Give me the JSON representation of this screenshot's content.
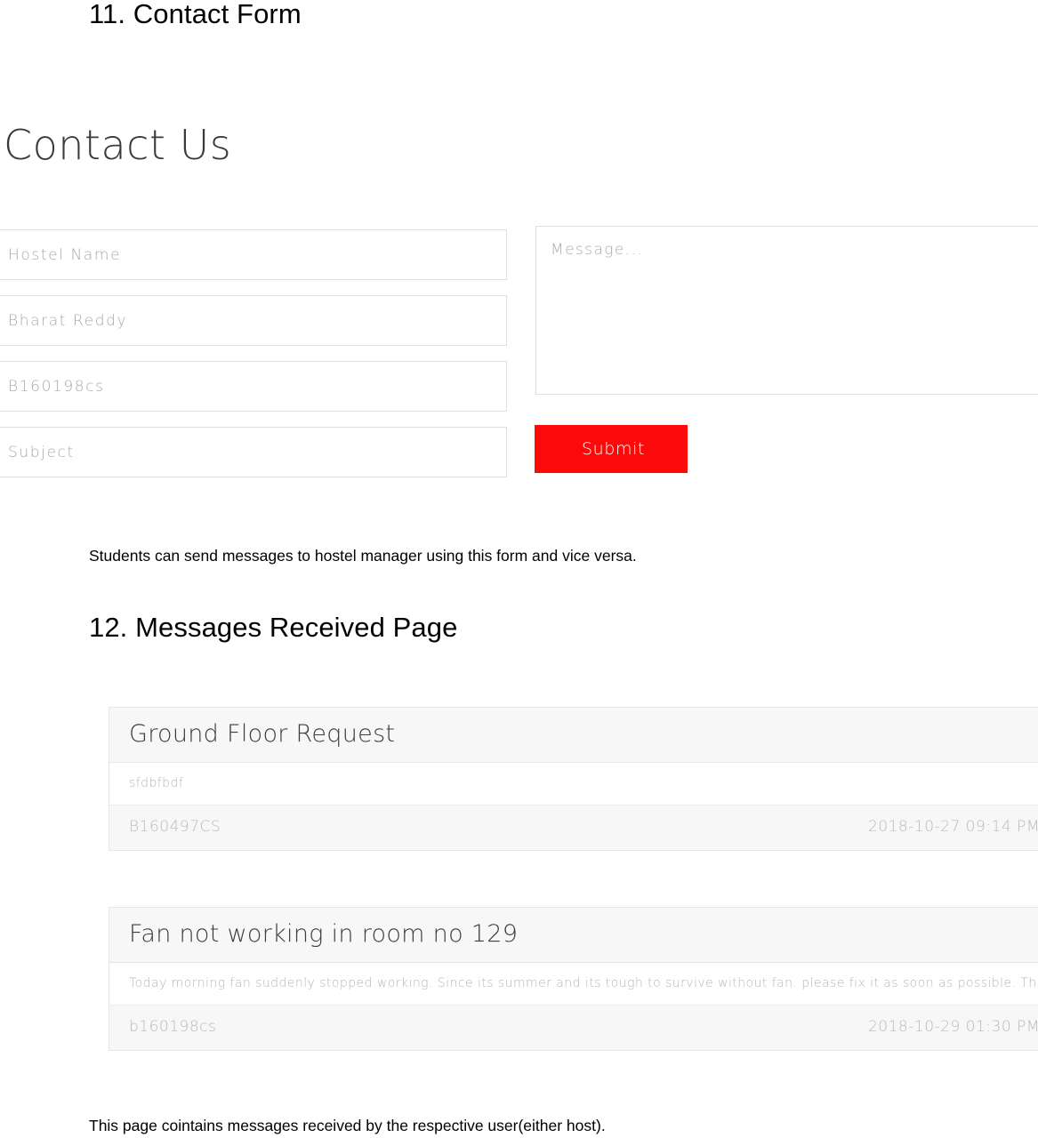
{
  "document": {
    "section_11": {
      "heading": "11. Contact Form",
      "caption": "Students can send messages to hostel manager using this form and vice versa."
    },
    "section_12": {
      "heading": "12. Messages Received Page",
      "caption": "This page cointains messages received by the respective user(either host)."
    }
  },
  "contact_form": {
    "title": "Contact Us",
    "fields": [
      {
        "name": "hostel-name",
        "value": "Hostel Name"
      },
      {
        "name": "student-name",
        "value": "Bharat Reddy"
      },
      {
        "name": "roll-number",
        "value": "B160198cs"
      },
      {
        "name": "subject",
        "value": "Subject"
      }
    ],
    "message": {
      "placeholder": "Message..."
    },
    "submit_label": "Submit",
    "submit_color": "#fc0a0a"
  },
  "messages_page": {
    "cards": [
      {
        "title": "Ground Floor Request",
        "body": "sfdbfbdf",
        "sender": "B160497CS",
        "timestamp": "2018-10-27 09:14 PM"
      },
      {
        "title": "Fan not working in room no 129",
        "body": "Today morning fan suddenly stopped working. Since its summer and its tough to survive without fan. please fix it as soon as possible. Thank you!",
        "sender": "b160198cs",
        "timestamp": "2018-10-29 01:30 PM"
      }
    ]
  }
}
